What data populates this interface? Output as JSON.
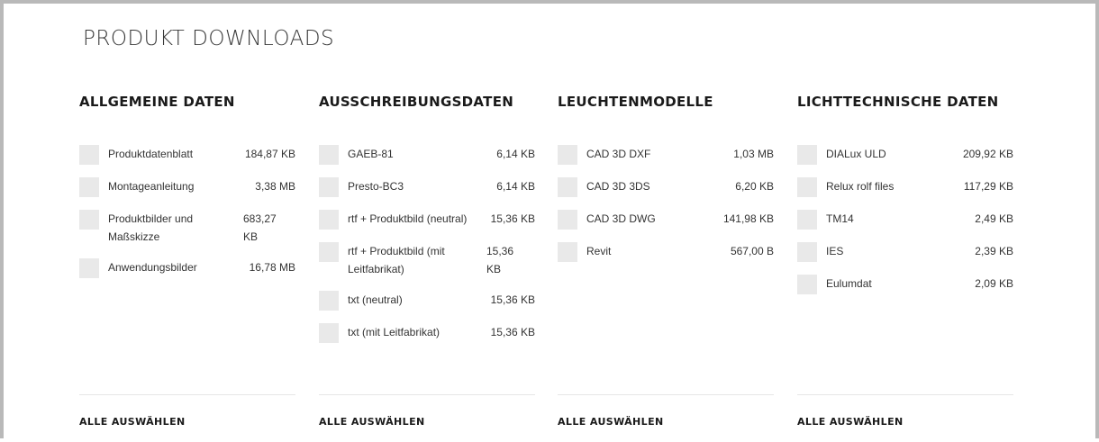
{
  "page": {
    "title": "PRODUKT DOWNLOADS"
  },
  "columns": [
    {
      "heading": "ALLGEMEINE DATEN",
      "select_all": "ALLE AUSWÄHLEN",
      "items": [
        {
          "name": "Produktdatenblatt",
          "size": "184,87 KB"
        },
        {
          "name": "Montageanleitung",
          "size": "3,38 MB"
        },
        {
          "name": "Produktbilder und Maßskizze",
          "size": "683,27 KB"
        },
        {
          "name": "Anwendungsbilder",
          "size": "16,78 MB"
        }
      ]
    },
    {
      "heading": "AUSSCHREIBUNGSDATEN",
      "select_all": "ALLE AUSWÄHLEN",
      "items": [
        {
          "name": "GAEB-81",
          "size": "6,14 KB"
        },
        {
          "name": "Presto-BC3",
          "size": "6,14 KB"
        },
        {
          "name": "rtf + Produktbild (neutral)",
          "size": "15,36 KB"
        },
        {
          "name": "rtf + Produktbild (mit Leitfabrikat)",
          "size": "15,36 KB"
        },
        {
          "name": "txt (neutral)",
          "size": "15,36 KB"
        },
        {
          "name": "txt (mit Leitfabrikat)",
          "size": "15,36 KB"
        }
      ]
    },
    {
      "heading": "LEUCHTENMODELLE",
      "select_all": "ALLE AUSWÄHLEN",
      "items": [
        {
          "name": "CAD 3D DXF",
          "size": "1,03 MB"
        },
        {
          "name": "CAD 3D 3DS",
          "size": "6,20 KB"
        },
        {
          "name": "CAD 3D DWG",
          "size": "141,98 KB"
        },
        {
          "name": "Revit",
          "size": "567,00 B"
        }
      ]
    },
    {
      "heading": "LICHTTECHNISCHE DATEN",
      "select_all": "ALLE AUSWÄHLEN",
      "items": [
        {
          "name": "DIALux ULD",
          "size": "209,92 KB"
        },
        {
          "name": "Relux rolf files",
          "size": "117,29 KB"
        },
        {
          "name": "TM14",
          "size": "2,49 KB"
        },
        {
          "name": "IES",
          "size": "2,39 KB"
        },
        {
          "name": "Eulumdat",
          "size": "2,09 KB"
        }
      ]
    }
  ]
}
